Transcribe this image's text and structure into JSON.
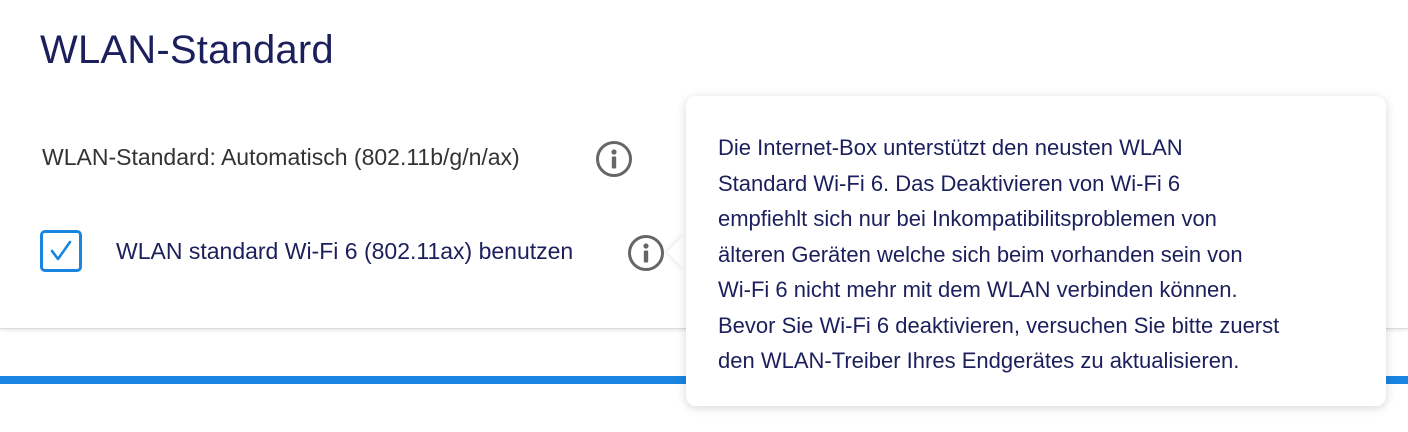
{
  "section": {
    "title": "WLAN-Standard"
  },
  "wlan_standard": {
    "label": "WLAN-Standard: Automatisch (802.11b/g/n/ax)"
  },
  "wifi6_option": {
    "label": "WLAN standard Wi-Fi 6 (802.11ax) benutzen",
    "checked": true
  },
  "tooltip": {
    "lines": [
      "Die Internet-Box unterstützt den neusten WLAN",
      "Standard Wi-Fi 6. Das Deaktivieren von Wi-Fi 6",
      "empfiehlt sich nur bei Inkompatibilitsproblemen von",
      "älteren Geräten welche sich beim vorhanden sein von",
      "Wi-Fi 6 nicht mehr mit dem WLAN verbinden können.",
      "Bevor Sie Wi-Fi 6 deaktivieren, versuchen Sie bitte zuerst",
      "den WLAN-Treiber Ihres Endgerätes zu aktualisieren."
    ]
  },
  "colors": {
    "accent": "#1a85e0",
    "title_text": "#1b1f5c",
    "body_text": "#333333",
    "icon": "#666666"
  }
}
